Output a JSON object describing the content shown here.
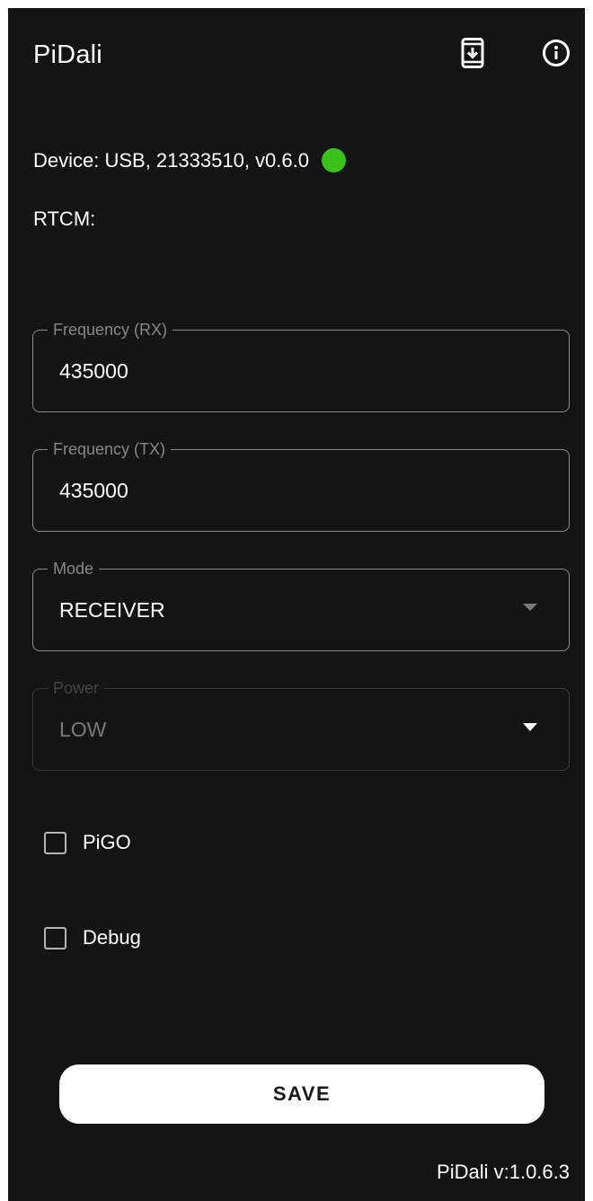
{
  "appbar": {
    "title": "PiDali",
    "icons": [
      "download-to-device-icon",
      "info-icon"
    ]
  },
  "status": {
    "device_text": "Device: USB, 21333510, v0.6.0",
    "connection_color": "#3ac21a",
    "rtcm_text": "RTCM:"
  },
  "form": {
    "frequency_rx": {
      "label": "Frequency (RX)",
      "value": "435000"
    },
    "frequency_tx": {
      "label": "Frequency (TX)",
      "value": "435000"
    },
    "mode": {
      "label": "Mode",
      "value": "RECEIVER"
    },
    "power": {
      "label": "Power",
      "value": "LOW",
      "disabled": true
    }
  },
  "checkboxes": {
    "pigo": {
      "label": "PiGO",
      "checked": false
    },
    "debug": {
      "label": "Debug",
      "checked": false
    }
  },
  "actions": {
    "save_label": "SAVE"
  },
  "footer": {
    "version": "PiDali v:1.0.6.3"
  },
  "colors": {
    "background": "#141414",
    "accent_connected": "#3ac21a",
    "outline": "#8a8a8a"
  }
}
